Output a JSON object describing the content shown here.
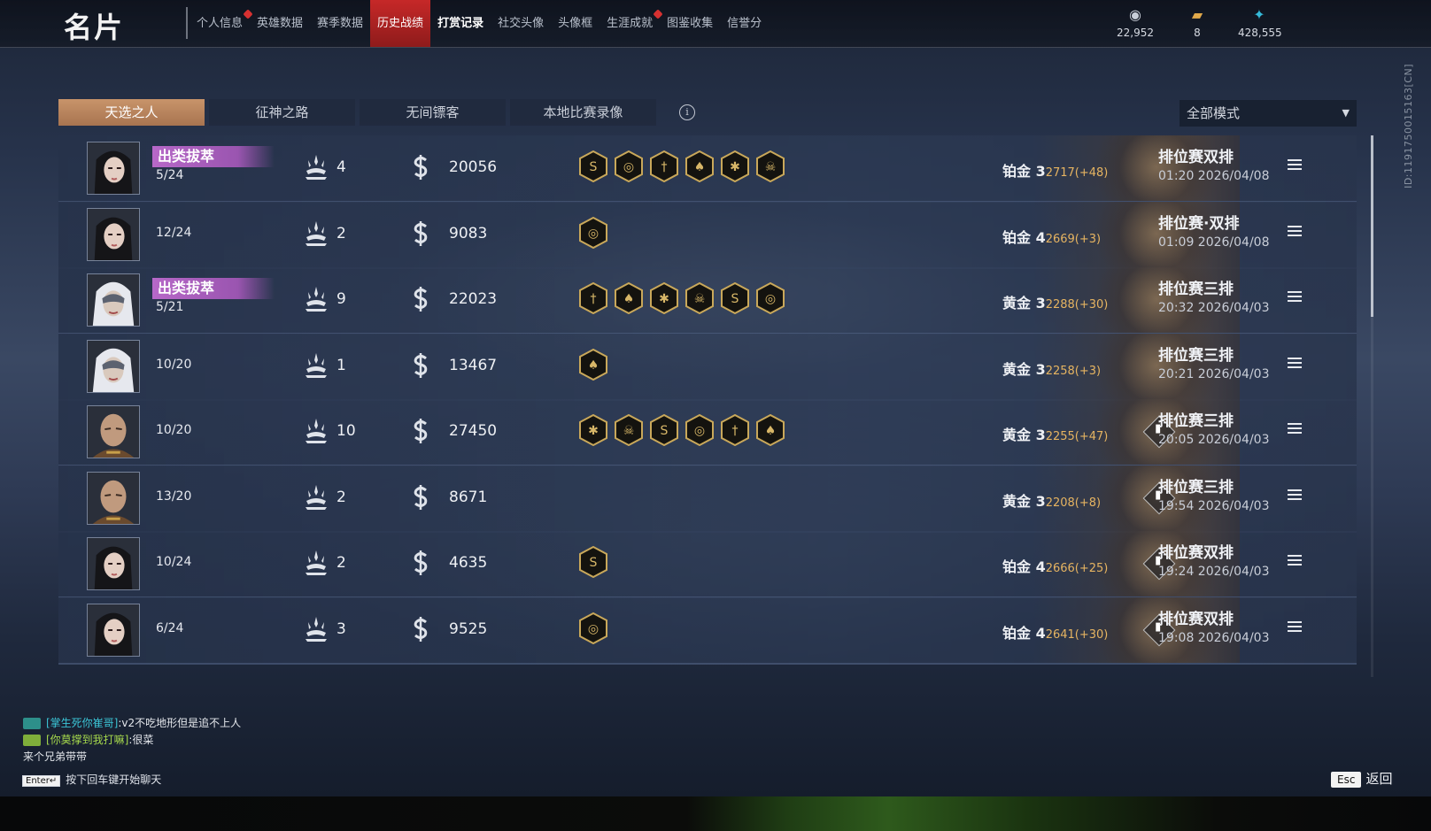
{
  "header": {
    "title": "名片",
    "tabs": [
      {
        "label": "个人信息",
        "dot": true,
        "state": "normal"
      },
      {
        "label": "英雄数据",
        "dot": false,
        "state": "normal"
      },
      {
        "label": "赛季数据",
        "dot": false,
        "state": "normal"
      },
      {
        "label": "历史战绩",
        "dot": false,
        "state": "active"
      },
      {
        "label": "打赏记录",
        "dot": false,
        "state": "bold"
      },
      {
        "label": "社交头像",
        "dot": false,
        "state": "normal"
      },
      {
        "label": "头像框",
        "dot": false,
        "state": "normal"
      },
      {
        "label": "生涯成就",
        "dot": true,
        "state": "normal"
      },
      {
        "label": "图鉴收集",
        "dot": false,
        "state": "normal"
      },
      {
        "label": "信誉分",
        "dot": false,
        "state": "normal"
      }
    ],
    "currency": [
      {
        "icon": "coin-stack-icon",
        "value": "22,952",
        "color": "#c9ced8"
      },
      {
        "icon": "ticket-icon",
        "value": "8",
        "color": "#e0a84a"
      },
      {
        "icon": "feather-gem-icon",
        "value": "428,555",
        "color": "#35b9d8"
      }
    ]
  },
  "side_id": "ID:1191750015163[CN]",
  "mode_tabs": [
    "天选之人",
    "征神之路",
    "无间镖客",
    "本地比赛录像"
  ],
  "mode_select": {
    "value": "全部模式"
  },
  "matches": [
    {
      "avatar": "female-dark",
      "tag": "出类拔萃",
      "kda": "5/24",
      "kills": "4",
      "score": "20056",
      "badges": 6,
      "rank": "铂金 3",
      "points": "2717(+48)",
      "chart": false,
      "mode": "排位赛双排",
      "time": "01:20  2026/04/08"
    },
    {
      "avatar": "female-dark",
      "tag": "",
      "kda": "12/24",
      "kills": "2",
      "score": "9083",
      "badges": 1,
      "rank": "铂金 4",
      "points": "2669(+3)",
      "chart": false,
      "mode": "排位赛·双排",
      "time": "01:09  2026/04/08"
    },
    {
      "avatar": "female-masked",
      "tag": "出类拔萃",
      "kda": "5/21",
      "kills": "9",
      "score": "22023",
      "badges": 6,
      "rank": "黄金 3",
      "points": "2288(+30)",
      "chart": false,
      "mode": "排位赛三排",
      "time": "20:32  2026/04/03"
    },
    {
      "avatar": "female-masked",
      "tag": "",
      "kda": "10/20",
      "kills": "1",
      "score": "13467",
      "badges": 1,
      "rank": "黄金 3",
      "points": "2258(+3)",
      "chart": false,
      "mode": "排位赛三排",
      "time": "20:21  2026/04/03"
    },
    {
      "avatar": "male-bald",
      "tag": "",
      "kda": "10/20",
      "kills": "10",
      "score": "27450",
      "badges": 6,
      "rank": "黄金 3",
      "points": "2255(+47)",
      "chart": true,
      "mode": "排位赛三排",
      "time": "20:05  2026/04/03"
    },
    {
      "avatar": "male-bald",
      "tag": "",
      "kda": "13/20",
      "kills": "2",
      "score": "8671",
      "badges": 0,
      "rank": "黄金 3",
      "points": "2208(+8)",
      "chart": true,
      "mode": "排位赛三排",
      "time": "19:54  2026/04/03"
    },
    {
      "avatar": "female-dark",
      "tag": "",
      "kda": "10/24",
      "kills": "2",
      "score": "4635",
      "badges": 1,
      "rank": "铂金 4",
      "points": "2666(+25)",
      "chart": true,
      "mode": "排位赛双排",
      "time": "19:24  2026/04/03"
    },
    {
      "avatar": "female-dark",
      "tag": "",
      "kda": "6/24",
      "kills": "3",
      "score": "9525",
      "badges": 1,
      "rank": "铂金 4",
      "points": "2641(+30)",
      "chart": true,
      "mode": "排位赛双排",
      "time": "19:08  2026/04/03"
    }
  ],
  "chat": [
    {
      "name": "[掌生死你崔哥]",
      "msg": ":v2不吃地形但是追不上人",
      "color": "cyan"
    },
    {
      "name": "[你莫撑到我打嘛]",
      "msg": ":很菜",
      "color": "green"
    },
    {
      "name": "",
      "msg": "来个兄弟带带",
      "color": "none"
    }
  ],
  "chat_hint": {
    "key": "Enter↵",
    "text": "按下回车键开始聊天"
  },
  "back": {
    "key": "Esc",
    "label": "返回"
  },
  "colors": {
    "active_tab": "#c62828",
    "mode_tab_active": "#b88260",
    "tag": "#b768c8",
    "points": "#e6b461"
  }
}
